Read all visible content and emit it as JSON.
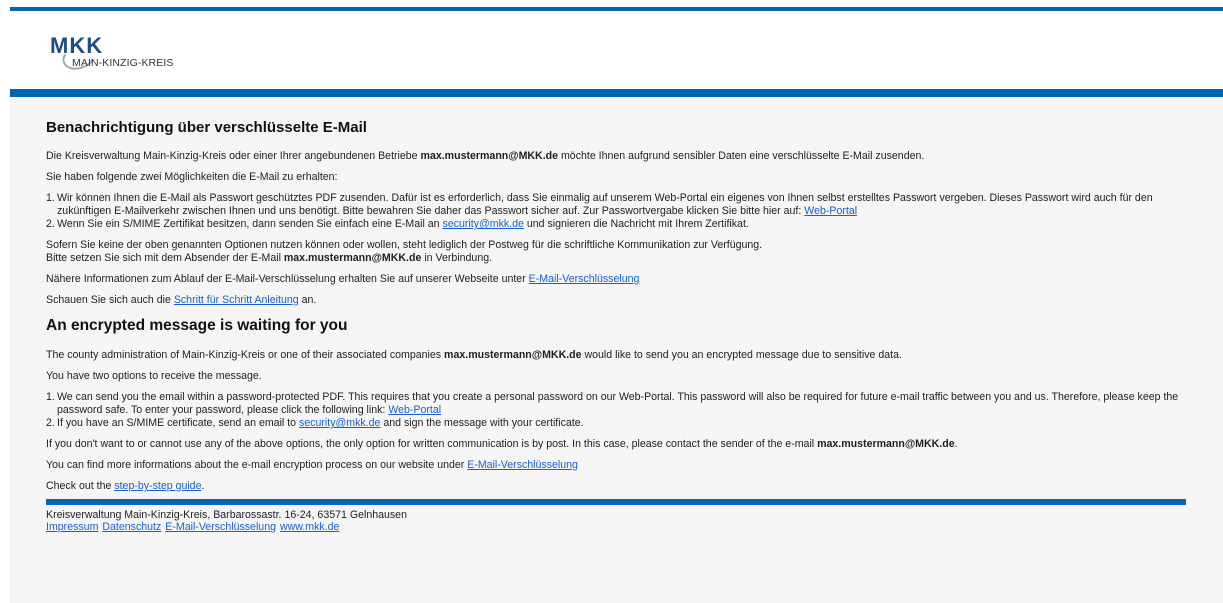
{
  "header": {
    "logo_mark": "MKK",
    "logo_sub": "MAIN-KINZIG-KREIS"
  },
  "de": {
    "title": "Benachrichtigung über verschlüsselte E-Mail",
    "intro_a": "Die Kreisverwaltung Main-Kinzig-Kreis oder einer Ihrer angebundenen Betriebe ",
    "intro_email": "max.mustermann@MKK.de",
    "intro_b": " möchte Ihnen aufgrund sensibler Daten eine verschlüsselte E-Mail zusenden.",
    "options_heading": "Sie haben folgende zwei Möglichkeiten die E-Mail zu erhalten:",
    "opt1_num": "1.",
    "opt1_text": "Wir können Ihnen die E-Mail als Passwort geschütztes PDF zusenden. Dafür ist es erforderlich, dass Sie einmalig auf unserem Web-Portal ein eigenes von Ihnen selbst erstelltes Passwort vergeben. Dieses Passwort wird auch für den zukünftigen E-Mailverkehr zwischen Ihnen und uns benötigt. Bitte bewahren Sie daher das Passwort sicher auf. Zur Passwortvergabe klicken Sie bitte hier auf: ",
    "opt1_link": "Web-Portal",
    "opt2_num": "2.",
    "opt2_a": "Wenn Sie ein S/MIME Zertifikat besitzen, dann senden Sie einfach eine E-Mail an ",
    "opt2_link": "security@mkk.de",
    "opt2_b": " und signieren die Nachricht mit Ihrem Zertifikat.",
    "post_line1": "Sofern Sie keine der oben genannten Optionen nutzen können oder wollen, steht lediglich der Postweg für die schriftliche Kommunikation zur Verfügung.",
    "post_line2_a": "Bitte setzen Sie sich mit dem Absender der E-Mail ",
    "post_email": "max.mustermann@MKK.de",
    "post_line2_b": " in Verbindung.",
    "info_a": "Nähere Informationen zum Ablauf der E-Mail-Verschlüsselung erhalten Sie auf unserer Webseite unter ",
    "info_link": "E-Mail-Verschlüsselung",
    "guide_a": "Schauen Sie sich auch die ",
    "guide_link": "Schritt für Schritt Anleitung",
    "guide_b": " an."
  },
  "en": {
    "title": "An encrypted message is waiting for you",
    "intro_a": "The county administration of Main-Kinzig-Kreis or one of their associated companies ",
    "intro_email": "max.mustermann@MKK.de",
    "intro_b": " would like to send you an encrypted message due to sensitive data.",
    "options_heading": "You have two options to receive the message.",
    "opt1_num": "1.",
    "opt1_text": "We can send you the email within a password-protected PDF. This requires that you create a personal password on our Web-Portal. This password will also be required for future e-mail traffic between you and us. Therefore, please keep the password safe. To enter your password, please click the following link: ",
    "opt1_link": "Web-Portal",
    "opt2_num": "2.",
    "opt2_a": "If you have an S/MIME certificate, send an email to ",
    "opt2_link": "security@mkk.de",
    "opt2_b": " and sign the message with your certificate.",
    "post_a": "If you don't want to or cannot use any of the above options, the only option for written communication is by post. In this case, please contact the sender of the e-mail ",
    "post_email": "max.mustermann@MKK.de",
    "post_b": ".",
    "info_a": "You can find more informations about the e-mail encryption process on our website under ",
    "info_link": "E-Mail-Verschlüsselung",
    "guide_a": "Check out the ",
    "guide_link": "step-by-step guide",
    "guide_b": "."
  },
  "footer": {
    "address": "Kreisverwaltung Main-Kinzig-Kreis, Barbarossastr. 16-24, 63571 Gelnhausen",
    "links": [
      "Impressum",
      "Datenschutz",
      "E-Mail-Verschlüsselung",
      "www.mkk.de"
    ]
  },
  "colors": {
    "accent": "#0066b3",
    "link": "#1a5fd1",
    "background": "#f5f5f5"
  }
}
